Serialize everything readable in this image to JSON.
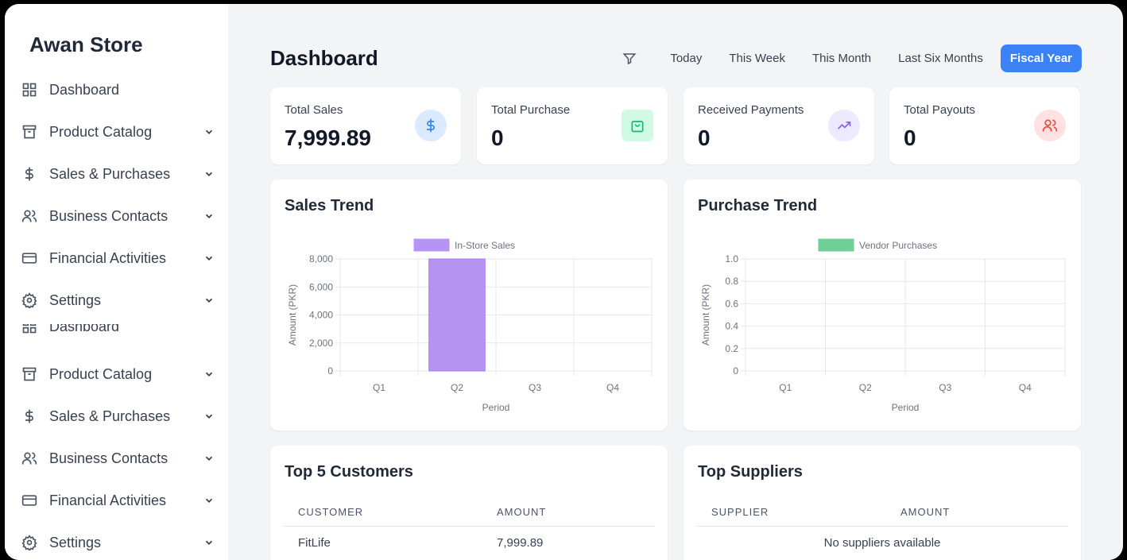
{
  "brand": "Awan Store",
  "sidebar": {
    "items": [
      {
        "label": "Dashboard",
        "icon": "grid-icon",
        "has_chevron": false
      },
      {
        "label": "Product Catalog",
        "icon": "archive-icon",
        "has_chevron": true
      },
      {
        "label": "Sales & Purchases",
        "icon": "dollar-icon",
        "has_chevron": true
      },
      {
        "label": "Business Contacts",
        "icon": "users-icon",
        "has_chevron": true
      },
      {
        "label": "Financial Activities",
        "icon": "credit-card-icon",
        "has_chevron": true
      },
      {
        "label": "Settings",
        "icon": "gear-icon",
        "has_chevron": true
      },
      {
        "label": "Dashboard",
        "icon": "grid-icon",
        "has_chevron": false
      },
      {
        "label": "Product Catalog",
        "icon": "archive-icon",
        "has_chevron": true
      },
      {
        "label": "Sales & Purchases",
        "icon": "dollar-icon",
        "has_chevron": true
      },
      {
        "label": "Business Contacts",
        "icon": "users-icon",
        "has_chevron": true
      },
      {
        "label": "Financial Activities",
        "icon": "credit-card-icon",
        "has_chevron": true
      },
      {
        "label": "Settings",
        "icon": "gear-icon",
        "has_chevron": true
      }
    ]
  },
  "header": {
    "title": "Dashboard",
    "filters": [
      "Today",
      "This Week",
      "This Month",
      "Last Six Months",
      "Fiscal Year"
    ],
    "active_filter": "Fiscal Year"
  },
  "stats": [
    {
      "label": "Total Sales",
      "value": "7,999.89",
      "icon": "dollar-icon",
      "icon_color": "#3b82f6",
      "icon_bg": "#dbeafe"
    },
    {
      "label": "Total Purchase",
      "value": "0",
      "icon": "shopping-bag-icon",
      "icon_color": "#10b981",
      "icon_bg": "#d1fae5"
    },
    {
      "label": "Received Payments",
      "value": "0",
      "icon": "trending-up-icon",
      "icon_color": "#8b5cf6",
      "icon_bg": "#ede9fe"
    },
    {
      "label": "Total Payouts",
      "value": "0",
      "icon": "users-icon",
      "icon_color": "#ef4444",
      "icon_bg": "#fee2e2"
    }
  ],
  "chart_data": [
    {
      "type": "bar",
      "title": "Sales Trend",
      "categories": [
        "Q1",
        "Q2",
        "Q3",
        "Q4"
      ],
      "series": [
        {
          "name": "In-Store Sales",
          "values": [
            0,
            8000,
            0,
            0
          ],
          "color": "#b794f4"
        }
      ],
      "xlabel": "Period",
      "ylabel": "Amount (PKR)",
      "ylim": [
        0,
        8000
      ],
      "yticks": [
        "8,000",
        "6,000",
        "4,000",
        "2,000",
        "0"
      ],
      "legend": "top",
      "grid": true
    },
    {
      "type": "bar",
      "title": "Purchase Trend",
      "categories": [
        "Q1",
        "Q2",
        "Q3",
        "Q4"
      ],
      "series": [
        {
          "name": "Vendor Purchases",
          "values": [
            0,
            0,
            0,
            0
          ],
          "color": "#6fcf97"
        }
      ],
      "xlabel": "Period",
      "ylabel": "Amount (PKR)",
      "ylim": [
        0,
        1.0
      ],
      "yticks": [
        "1.0",
        "0.8",
        "0.6",
        "0.4",
        "0.2",
        "0"
      ],
      "legend": "top",
      "grid": true
    }
  ],
  "customers": {
    "title": "Top 5 Customers",
    "col_customer": "CUSTOMER",
    "col_amount": "AMOUNT",
    "rows": [
      {
        "name": "FitLife",
        "amount": "7,999.89"
      }
    ]
  },
  "suppliers": {
    "title": "Top Suppliers",
    "col_supplier": "SUPPLIER",
    "col_amount": "AMOUNT",
    "empty": "No suppliers available"
  }
}
